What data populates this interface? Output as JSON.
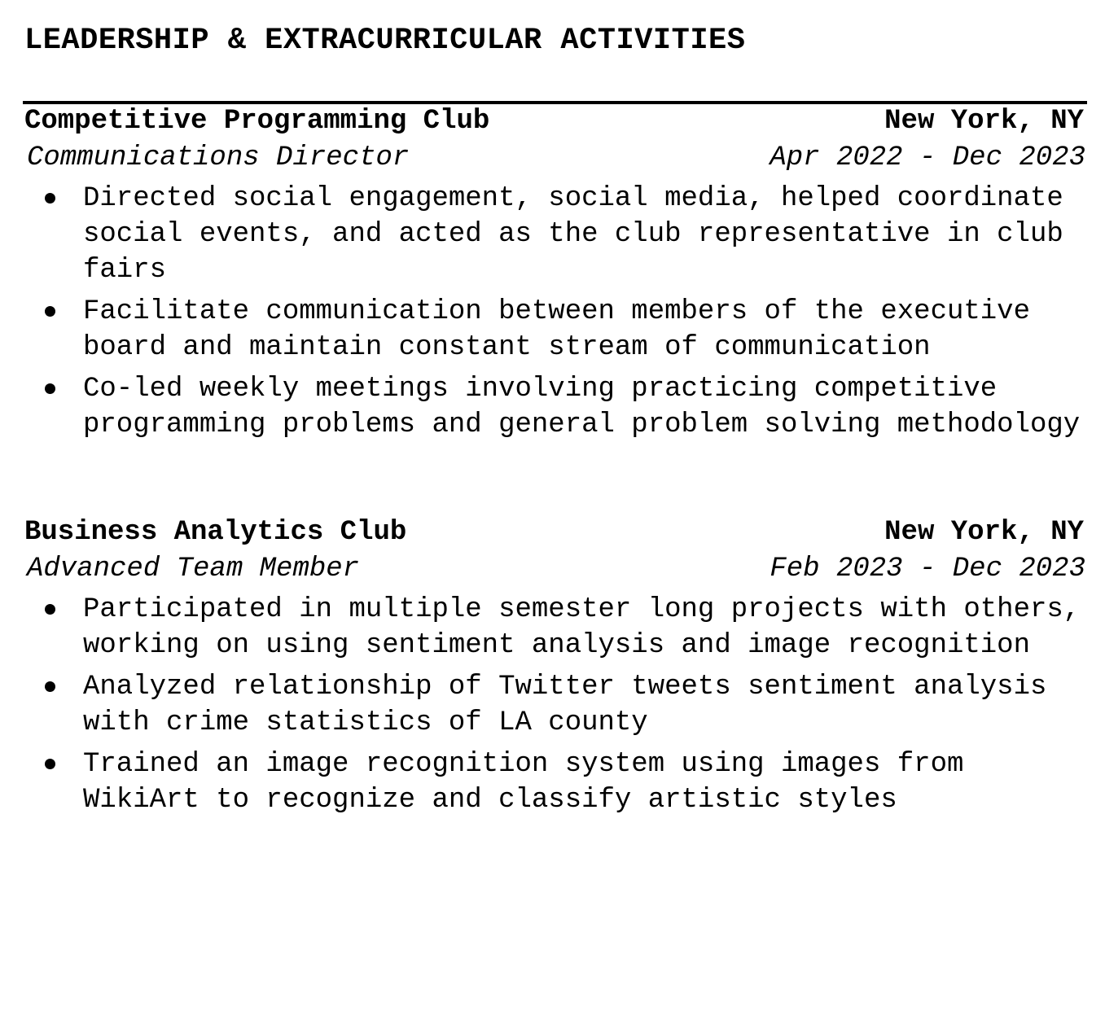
{
  "section": {
    "title": "LEADERSHIP & EXTRACURRICULAR ACTIVITIES"
  },
  "entries": [
    {
      "organization": "Competitive Programming Club",
      "location": "New York, NY",
      "role": "Communications Director",
      "dates": "Apr 2022 - Dec 2023",
      "bullets": [
        "Directed social engagement, social media, helped coordinate social events, and acted as the club representative in club fairs",
        "Facilitate communication between members of the executive board and maintain constant stream of communication",
        "Co-led weekly meetings involving practicing competitive programming problems and general problem solving methodology"
      ]
    },
    {
      "organization": "Business Analytics Club",
      "location": "New York, NY",
      "role": "Advanced Team Member",
      "dates": "Feb 2023 - Dec 2023",
      "bullets": [
        "Participated in multiple semester long projects with others, working on using sentiment analysis and image recognition",
        "Analyzed relationship of Twitter tweets sentiment analysis with crime statistics of LA county",
        "Trained an image recognition system using images from WikiArt to recognize and classify artistic styles"
      ]
    }
  ]
}
